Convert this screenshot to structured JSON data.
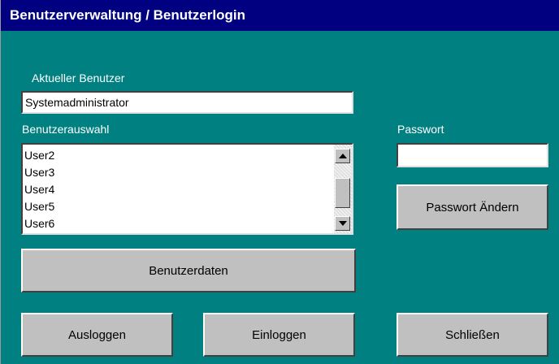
{
  "window": {
    "title": "Benutzerverwaltung / Benutzerlogin"
  },
  "current_user": {
    "label": "Aktueller Benutzer",
    "value": "Systemadministrator"
  },
  "user_selection": {
    "label": "Benutzerauswahl",
    "items": [
      "User2",
      "User3",
      "User4",
      "User5",
      "User6"
    ]
  },
  "password": {
    "label": "Passwort",
    "value": ""
  },
  "buttons": {
    "change_password": "Passwort Ändern",
    "user_data": "Benutzerdaten",
    "logout": "Ausloggen",
    "login": "Einloggen",
    "close": "Schließen"
  },
  "colors": {
    "window_bg": "#008080",
    "titlebar_bg": "#000080",
    "button_face": "#c0c0c0"
  }
}
